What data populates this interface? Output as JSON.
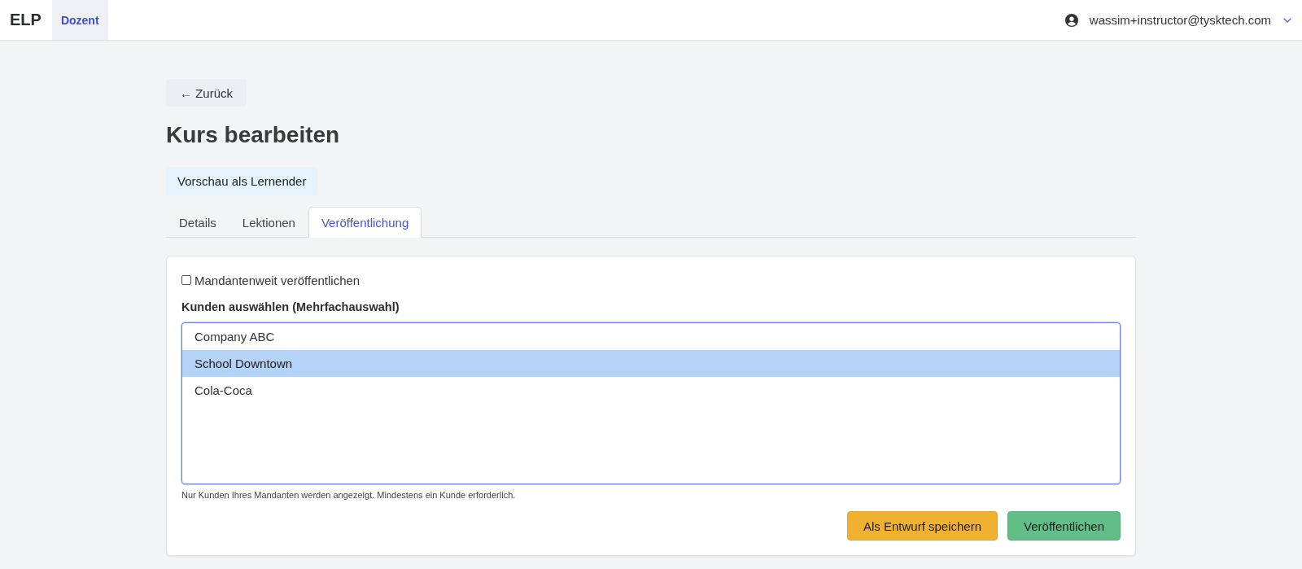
{
  "header": {
    "logo": "ELP",
    "nav": [
      {
        "label": "Dozent",
        "selected": true
      }
    ],
    "user": {
      "email": "wassim+instructor@tysktech.com"
    }
  },
  "back_button": "← Zurück",
  "title": "Kurs bearbeiten",
  "preview_button": "Vorschau als Lernender",
  "tabs": [
    {
      "label": "Details",
      "selected": false
    },
    {
      "label": "Lektionen",
      "selected": false
    },
    {
      "label": "Veröffentlichung",
      "selected": true
    }
  ],
  "publish_panel": {
    "tenant_wide": {
      "label": "Mandantenweit veröffentlichen",
      "checked": false
    },
    "customers": {
      "label": "Kunden auswählen (Mehrfachauswahl)",
      "focused": true,
      "options": [
        {
          "label": "Company ABC",
          "selected": false
        },
        {
          "label": "School Downtown",
          "selected": true
        },
        {
          "label": "Cola-Coca",
          "selected": false
        }
      ]
    },
    "hint": "Nur Kunden Ihres Mandanten werden angezeigt. Mindestens ein Kunde erforderlich.",
    "buttons": [
      {
        "label": "Als Entwurf speichern",
        "kind": "draft"
      },
      {
        "label": "Veröffentlichen",
        "kind": "publish"
      }
    ]
  }
}
